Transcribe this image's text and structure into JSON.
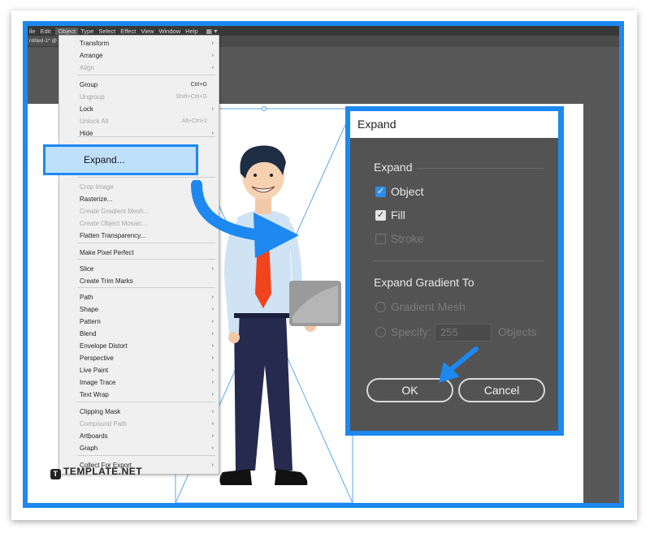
{
  "menubar": {
    "items": [
      "ile",
      "Edit",
      "Object",
      "Type",
      "Select",
      "Effect",
      "View",
      "Window",
      "Help"
    ],
    "active": "Object"
  },
  "document_tab": {
    "title": "ntitled-1* @"
  },
  "object_menu": {
    "items": [
      {
        "label": "Transform",
        "shortcut": "",
        "submenu": true,
        "disabled": false
      },
      {
        "label": "Arrange",
        "shortcut": "",
        "submenu": true,
        "disabled": false
      },
      {
        "label": "Align",
        "shortcut": "",
        "submenu": true,
        "disabled": true
      },
      {
        "label": "Group",
        "shortcut": "Ctrl+G",
        "submenu": false,
        "disabled": false
      },
      {
        "label": "Ungroup",
        "shortcut": "Shift+Ctrl+G",
        "submenu": false,
        "disabled": true
      },
      {
        "label": "Lock",
        "shortcut": "",
        "submenu": true,
        "disabled": false
      },
      {
        "label": "Unlock All",
        "shortcut": "Alt+Ctrl+2",
        "submenu": false,
        "disabled": true
      },
      {
        "label": "Hide",
        "shortcut": "",
        "submenu": true,
        "disabled": false
      },
      {
        "label": "Expand...",
        "shortcut": "",
        "submenu": false,
        "disabled": false
      },
      {
        "label": "Crop Image",
        "shortcut": "",
        "submenu": false,
        "disabled": true
      },
      {
        "label": "Rasterize...",
        "shortcut": "",
        "submenu": false,
        "disabled": false
      },
      {
        "label": "Create Gradient Mesh...",
        "shortcut": "",
        "submenu": false,
        "disabled": true
      },
      {
        "label": "Create Object Mosaic...",
        "shortcut": "",
        "submenu": false,
        "disabled": true
      },
      {
        "label": "Flatten Transparency...",
        "shortcut": "",
        "submenu": false,
        "disabled": false
      },
      {
        "label": "Make Pixel Perfect",
        "shortcut": "",
        "submenu": false,
        "disabled": false
      },
      {
        "label": "Slice",
        "shortcut": "",
        "submenu": true,
        "disabled": false
      },
      {
        "label": "Create Trim Marks",
        "shortcut": "",
        "submenu": false,
        "disabled": false
      },
      {
        "label": "Path",
        "shortcut": "",
        "submenu": true,
        "disabled": false
      },
      {
        "label": "Shape",
        "shortcut": "",
        "submenu": true,
        "disabled": false
      },
      {
        "label": "Pattern",
        "shortcut": "",
        "submenu": true,
        "disabled": false
      },
      {
        "label": "Blend",
        "shortcut": "",
        "submenu": true,
        "disabled": false
      },
      {
        "label": "Envelope Distort",
        "shortcut": "",
        "submenu": true,
        "disabled": false
      },
      {
        "label": "Perspective",
        "shortcut": "",
        "submenu": true,
        "disabled": false
      },
      {
        "label": "Live Paint",
        "shortcut": "",
        "submenu": true,
        "disabled": false
      },
      {
        "label": "Image Trace",
        "shortcut": "",
        "submenu": true,
        "disabled": false
      },
      {
        "label": "Text Wrap",
        "shortcut": "",
        "submenu": true,
        "disabled": false
      },
      {
        "label": "Clipping Mask",
        "shortcut": "",
        "submenu": true,
        "disabled": false
      },
      {
        "label": "Compound Path",
        "shortcut": "",
        "submenu": true,
        "disabled": true
      },
      {
        "label": "Artboards",
        "shortcut": "",
        "submenu": true,
        "disabled": false
      },
      {
        "label": "Graph",
        "shortcut": "",
        "submenu": true,
        "disabled": false
      },
      {
        "label": "Collect For Export",
        "shortcut": "",
        "submenu": true,
        "disabled": false
      }
    ],
    "highlighted": "Expand..."
  },
  "expand_dialog": {
    "title": "Expand",
    "expand_group_label": "Expand",
    "object_label": "Object",
    "object_checked": true,
    "fill_label": "Fill",
    "fill_checked": true,
    "stroke_label": "Stroke",
    "stroke_checked": false,
    "gradient_group_label": "Expand Gradient To",
    "gradient_mesh_label": "Gradient Mesh",
    "specify_label": "Specify:",
    "specify_value": "255",
    "objects_label": "Objects",
    "ok_label": "OK",
    "cancel_label": "Cancel"
  },
  "watermark": {
    "text": "TEMPLATE.NET"
  },
  "colors": {
    "accent_blue": "#1c88f0",
    "highlight": "#bfe0fb",
    "dialog_bg": "#535353",
    "menu_bg": "#f0f0f0"
  }
}
